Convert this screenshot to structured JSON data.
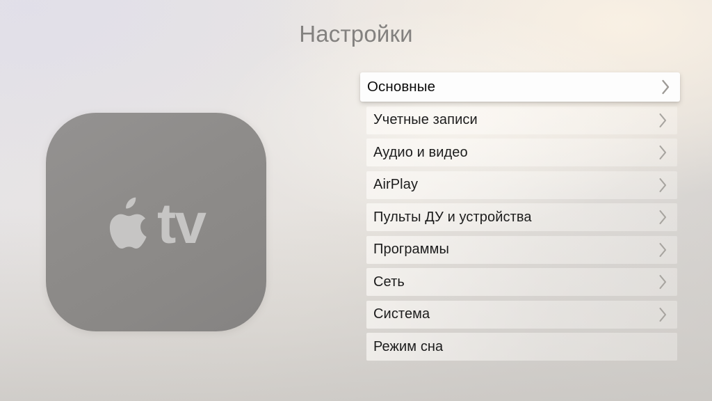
{
  "screen": {
    "title": "Настройки",
    "background_colors": {
      "top_left": "#E3E1E6",
      "top_right": "#F5EFE7",
      "bottom_left": "#CFCECC",
      "bottom_right": "#D5D2CE"
    }
  },
  "device_icon": {
    "name": "apple-tv-icon",
    "wordmark": "tv",
    "apple_glyph": "apple-logo-icon",
    "tile_color": "#8E8C8A",
    "glyph_color": "#C6C5C4"
  },
  "menu": {
    "selected_index": 0,
    "chevron_icon": "chevron-right-icon",
    "items": [
      {
        "label": "Основные",
        "has_chevron": true,
        "selected": true
      },
      {
        "label": "Учетные записи",
        "has_chevron": true,
        "selected": false
      },
      {
        "label": "Аудио и видео",
        "has_chevron": true,
        "selected": false
      },
      {
        "label": "AirPlay",
        "has_chevron": true,
        "selected": false
      },
      {
        "label": "Пульты ДУ и устройства",
        "has_chevron": true,
        "selected": false
      },
      {
        "label": "Программы",
        "has_chevron": true,
        "selected": false
      },
      {
        "label": "Сеть",
        "has_chevron": true,
        "selected": false
      },
      {
        "label": "Система",
        "has_chevron": true,
        "selected": false
      },
      {
        "label": "Режим сна",
        "has_chevron": false,
        "selected": false
      }
    ]
  }
}
